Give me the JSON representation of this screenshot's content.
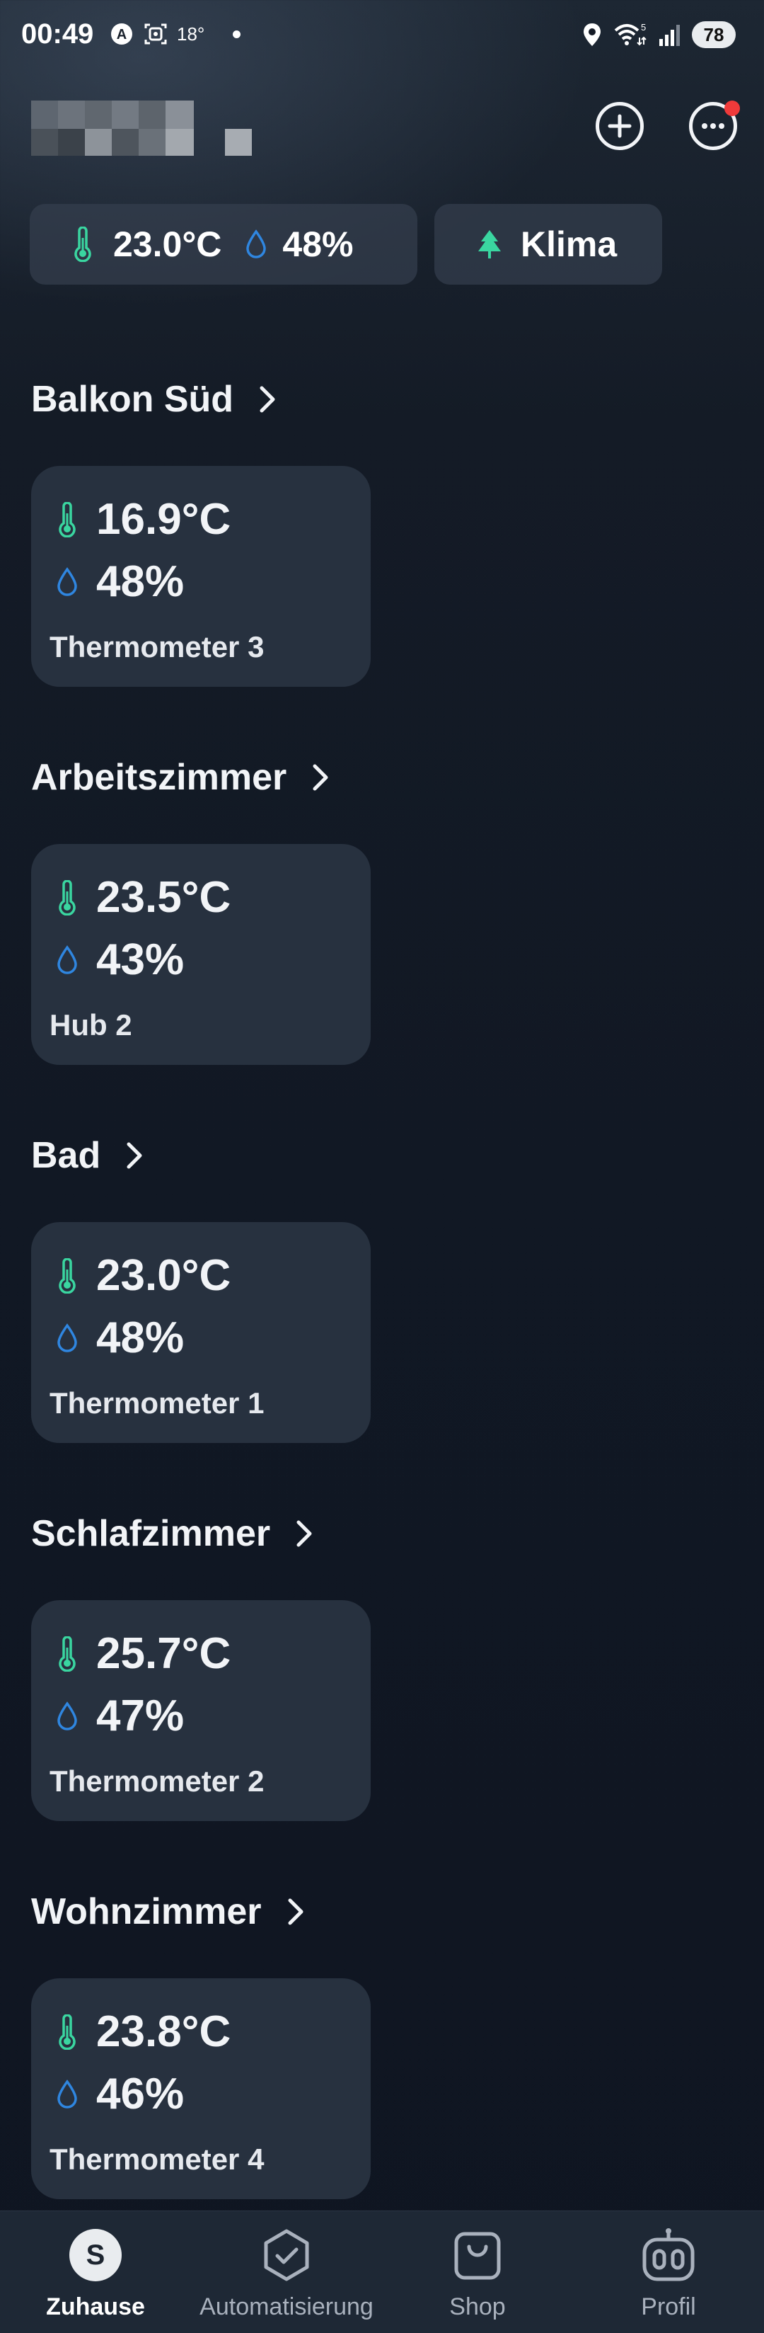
{
  "status_bar": {
    "time": "00:49",
    "temperature": "18°",
    "battery": "78",
    "wifi_badge": "5"
  },
  "header": {
    "home_name_redacted": true,
    "add_icon": "plus-circle-icon",
    "more_icon": "more-dots-icon",
    "notification_dot_color": "#ef3a3a"
  },
  "summary": {
    "temperature": "23.0°C",
    "humidity": "48%",
    "klima_label": "Klima"
  },
  "rooms": [
    {
      "name": "Balkon Süd",
      "temperature": "16.9°C",
      "humidity": "48%",
      "device": "Thermometer 3"
    },
    {
      "name": "Arbeitszimmer",
      "temperature": "23.5°C",
      "humidity": "43%",
      "device": "Hub 2"
    },
    {
      "name": "Bad",
      "temperature": "23.0°C",
      "humidity": "48%",
      "device": "Thermometer 1"
    },
    {
      "name": "Schlafzimmer",
      "temperature": "25.7°C",
      "humidity": "47%",
      "device": "Thermometer 2"
    },
    {
      "name": "Wohnzimmer",
      "temperature": "23.8°C",
      "humidity": "46%",
      "device": "Thermometer 4"
    }
  ],
  "bottom_nav": {
    "home": {
      "label": "Zuhause",
      "avatar_letter": "S",
      "active": true
    },
    "automation": {
      "label": "Automatisierung",
      "active": false
    },
    "shop": {
      "label": "Shop",
      "active": false
    },
    "profile": {
      "label": "Profil",
      "active": false
    }
  },
  "colors": {
    "thermometer": "#3ad6a0",
    "humidity": "#2f86e0",
    "klima_tree": "#3ad6a0",
    "card_bg": "#27313f"
  }
}
